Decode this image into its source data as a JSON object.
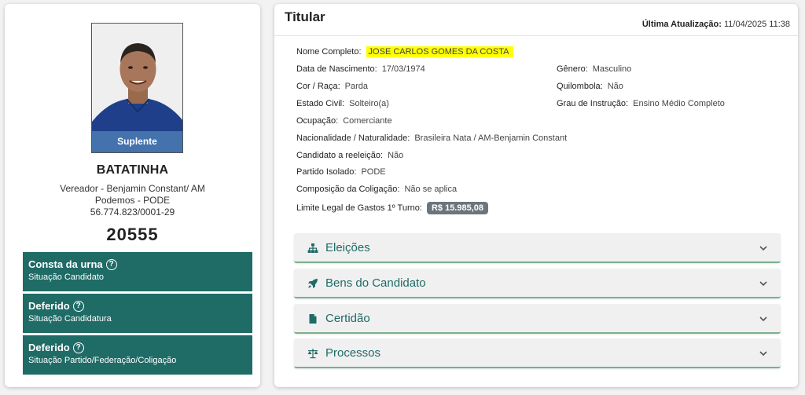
{
  "candidate": {
    "badge": "Suplente",
    "name": "BATATINHA",
    "office": "Vereador - Benjamin Constant/ AM",
    "party": "Podemos - PODE",
    "cnpj": "56.774.823/0001-29",
    "number": "20555"
  },
  "status_boxes": [
    {
      "title": "Consta da urna",
      "subtitle": "Situação Candidato"
    },
    {
      "title": "Deferido",
      "subtitle": "Situação Candidatura"
    },
    {
      "title": "Deferido",
      "subtitle": "Situação Partido/Federação/Coligação"
    }
  ],
  "details": {
    "title": "Titular",
    "update_label": "Última Atualização:",
    "update_value": "11/04/2025 11:38",
    "fields": {
      "nome_completo": {
        "label": "Nome Completo:",
        "value": "JOSE CARLOS GOMES DA COSTA"
      },
      "data_nascimento": {
        "label": "Data de Nascimento:",
        "value": "17/03/1974"
      },
      "genero": {
        "label": "Gênero:",
        "value": "Masculino"
      },
      "cor_raca": {
        "label": "Cor / Raça:",
        "value": "Parda"
      },
      "quilombola": {
        "label": "Quilombola:",
        "value": "Não"
      },
      "estado_civil": {
        "label": "Estado Civil:",
        "value": "Solteiro(a)"
      },
      "grau_instrucao": {
        "label": "Grau de Instrução:",
        "value": "Ensino Médio Completo"
      },
      "ocupacao": {
        "label": "Ocupação:",
        "value": "Comerciante"
      },
      "nacionalidade": {
        "label": "Nacionalidade / Naturalidade:",
        "value": "Brasileira Nata / AM-Benjamin Constant"
      },
      "reeleicao": {
        "label": "Candidato a reeleição:",
        "value": "Não"
      },
      "partido_isolado": {
        "label": "Partido Isolado:",
        "value": "PODE"
      },
      "composicao": {
        "label": "Composição da Coligação:",
        "value": "Não se aplica"
      },
      "limite_gastos": {
        "label": "Limite Legal de Gastos 1º Turno:",
        "value": "R$ 15.985,08"
      }
    }
  },
  "accordions": [
    {
      "label": "Eleições",
      "icon": "sitemap-icon"
    },
    {
      "label": "Bens do Candidato",
      "icon": "rocket-icon"
    },
    {
      "label": "Certidão",
      "icon": "document-icon"
    },
    {
      "label": "Processos",
      "icon": "scale-icon"
    }
  ],
  "colors": {
    "accent": "#1f6b66",
    "badge": "#4876b0",
    "highlight": "#ffff00",
    "money_badge": "#6c757d"
  }
}
